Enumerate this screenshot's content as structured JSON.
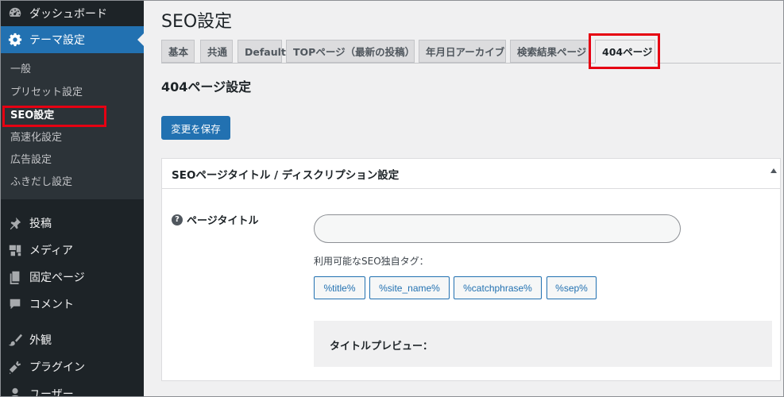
{
  "sidebar": {
    "top_items": [
      {
        "label": "ダッシュボード",
        "icon": "dashboard-icon"
      },
      {
        "label": "テーマ設定",
        "icon": "gear-icon"
      }
    ],
    "submenu": [
      "一般",
      "プリセット設定",
      "SEO設定",
      "高速化設定",
      "広告設定",
      "ふきだし設定"
    ],
    "active_submenu": "SEO設定",
    "bottom_items": [
      {
        "label": "投稿",
        "icon": "pin-icon"
      },
      {
        "label": "メディア",
        "icon": "media-icon"
      },
      {
        "label": "固定ページ",
        "icon": "page-icon"
      },
      {
        "label": "コメント",
        "icon": "comment-icon"
      },
      {
        "label": "外観",
        "icon": "brush-icon"
      },
      {
        "label": "プラグイン",
        "icon": "plugin-icon"
      },
      {
        "label": "ユーザー",
        "icon": "user-icon"
      }
    ]
  },
  "page": {
    "title": "SEO設定",
    "tabs": [
      "基本",
      "共通",
      "Default",
      "TOPページ（最新の投稿）",
      "年月日アーカイブ",
      "検索結果ページ",
      "404ページ"
    ],
    "active_tab": "404ページ",
    "section_title": "404ページ設定",
    "save_label": "変更を保存"
  },
  "panel": {
    "title": "SEOページタイトル / ディスクリプション設定",
    "field_label": "ページタイトル",
    "field_value": "",
    "tags_label": "利用可能なSEO独自タグ：",
    "tags": [
      "%title%",
      "%site_name%",
      "%catchphrase%",
      "%sep%"
    ],
    "preview_label": "タイトルプレビュー："
  },
  "colors": {
    "sidebar_bg": "#1d2327",
    "accent": "#2271b1",
    "highlight_box": "#e60012"
  }
}
